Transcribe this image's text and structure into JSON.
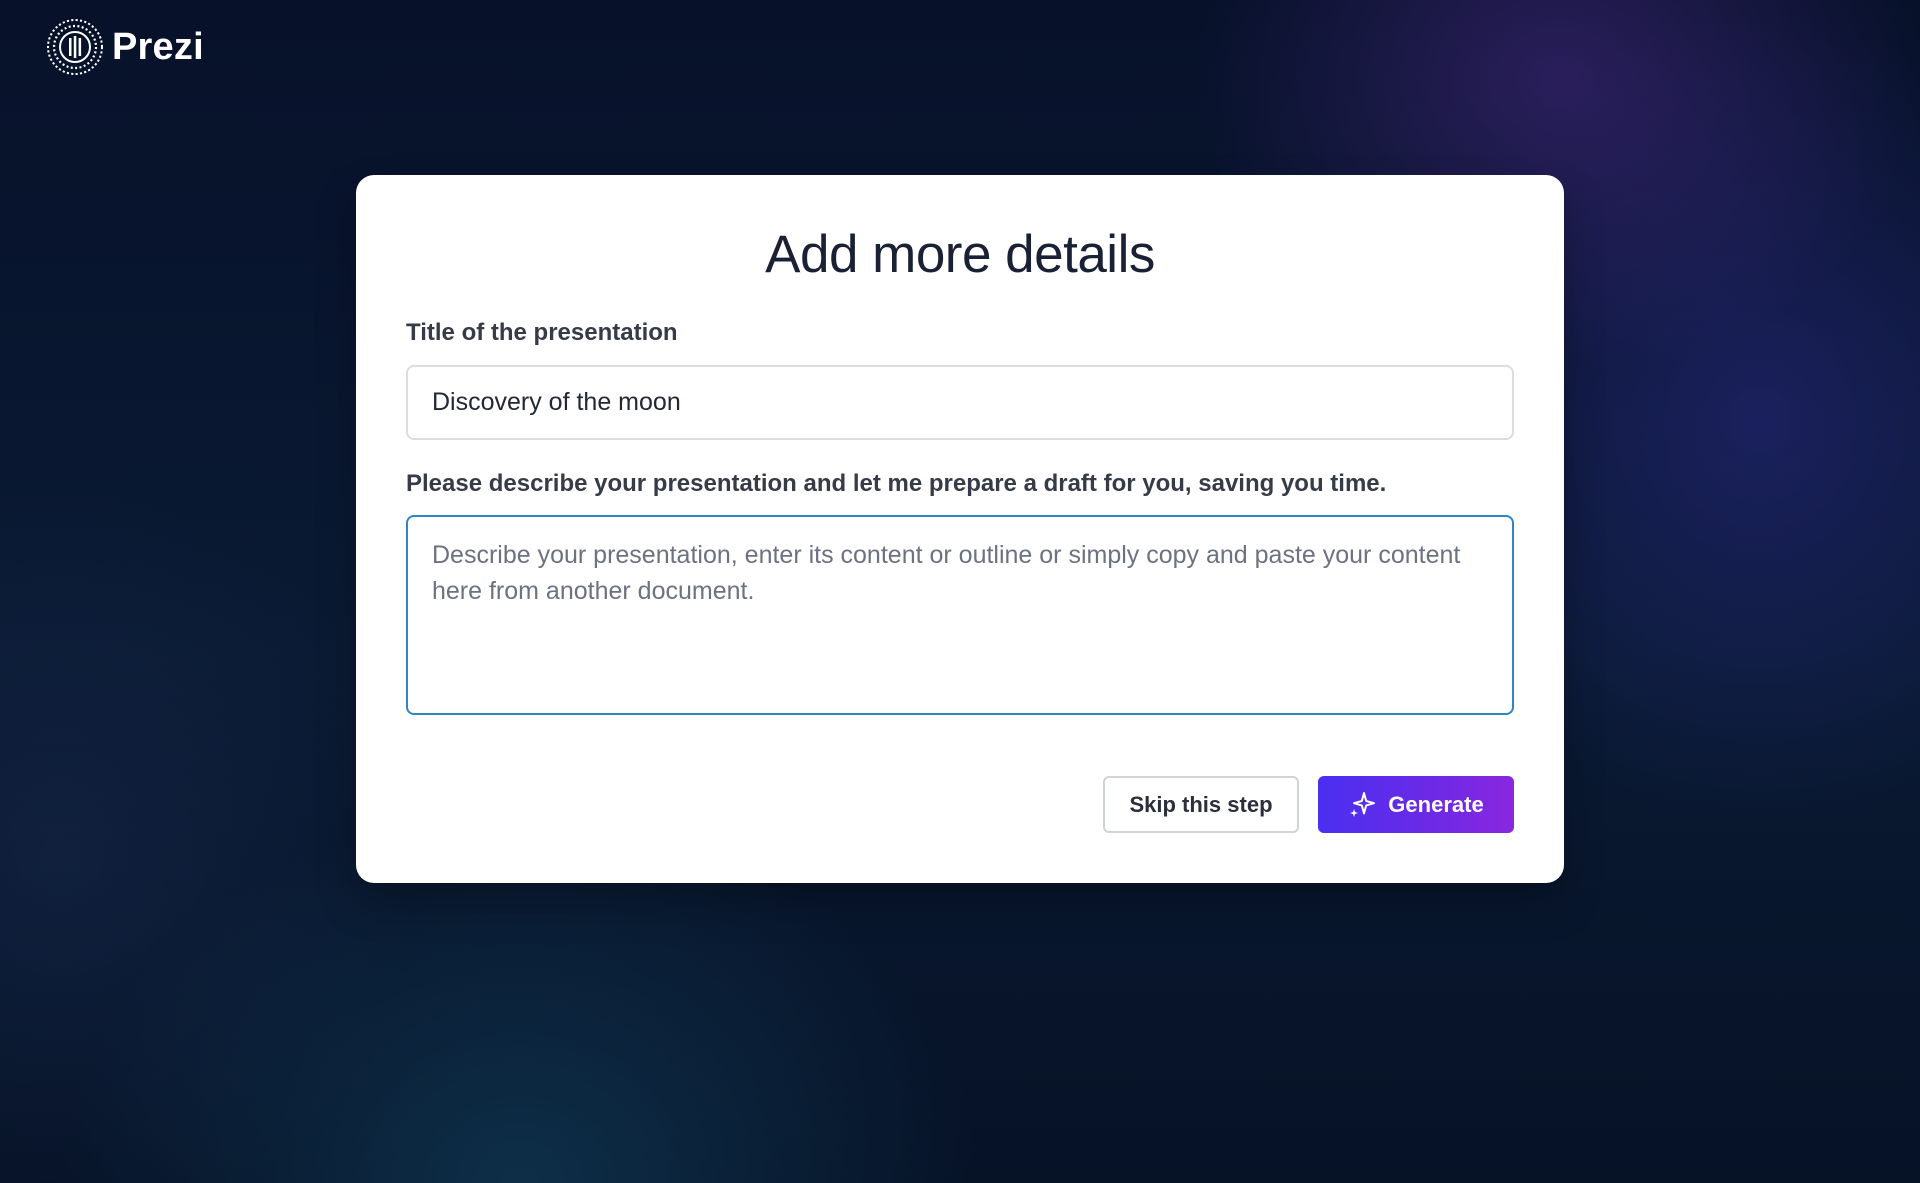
{
  "brand": {
    "name": "Prezi",
    "logo_icon": "prezi-logo-icon"
  },
  "modal": {
    "title": "Add more details",
    "title_field": {
      "label": "Title of the presentation",
      "value": "Discovery of the moon"
    },
    "description_field": {
      "label": "Please describe your presentation and let me prepare a draft for you, saving you time.",
      "value": "",
      "placeholder": "Describe your presentation, enter its content or outline or simply copy and paste your content here from another document."
    },
    "buttons": {
      "skip_label": "Skip this step",
      "generate_label": "Generate",
      "generate_icon": "sparkle-icon"
    }
  },
  "colors": {
    "background": "#081329",
    "modal": "#ffffff",
    "accent_start": "#4a2ff0",
    "accent_end": "#8a27df",
    "focus_border": "#2f86c4"
  }
}
